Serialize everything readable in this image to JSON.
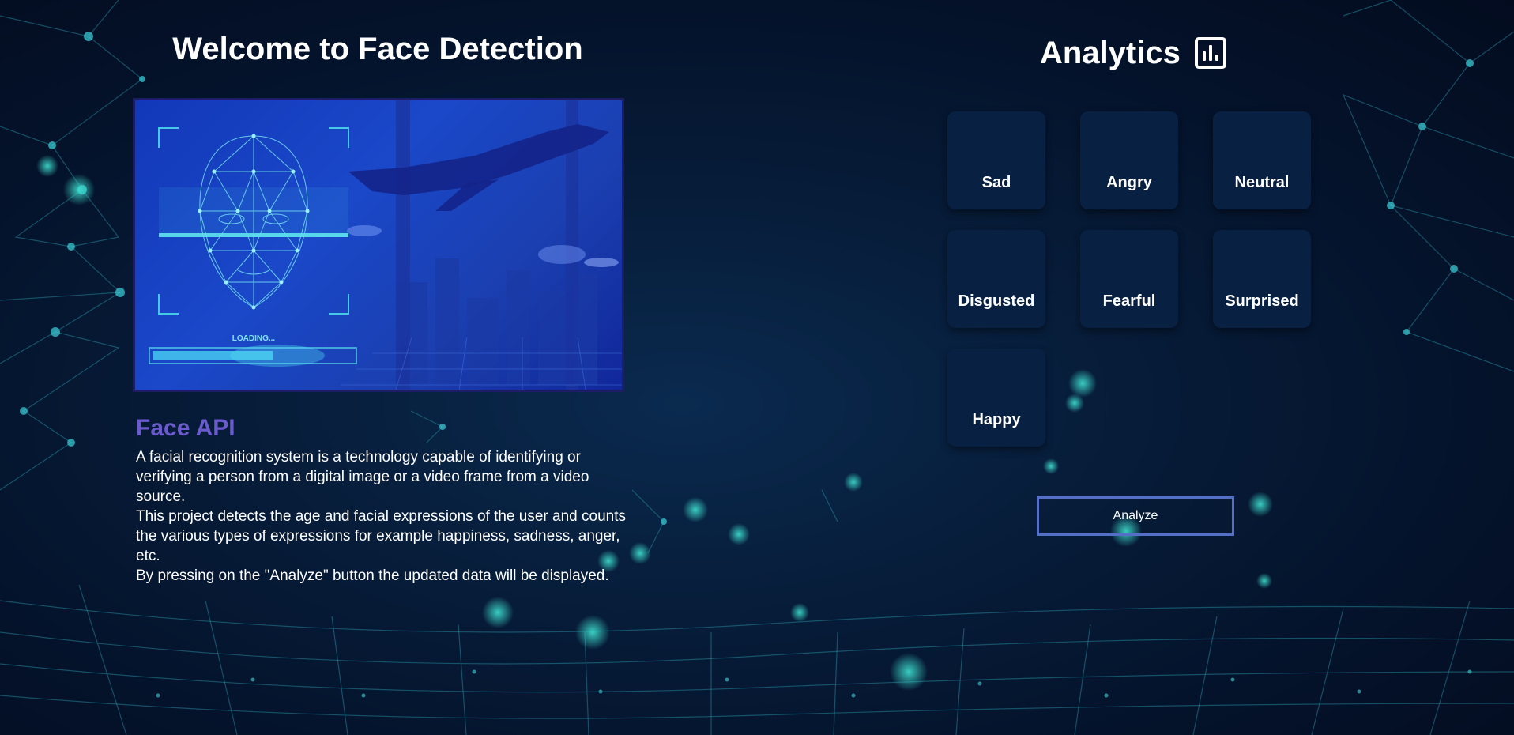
{
  "header": {
    "title": "Welcome to Face Detection"
  },
  "hero_image": {
    "loading_text": "LOADING...",
    "loading_progress": 0.6
  },
  "about": {
    "title": "Face API",
    "paragraphs": [
      "A facial recognition system is a technology capable of identifying or verifying a person from a digital image or a video frame from a video source.",
      "This project detects the age and facial expressions of the user and counts the various types of expressions for example happiness, sadness, anger, etc.",
      "By pressing on the \"Analyze\" button the updated data will be displayed."
    ]
  },
  "analytics": {
    "title": "Analytics",
    "icon": "bar-chart-icon",
    "cards": [
      {
        "label": "Sad"
      },
      {
        "label": "Angry"
      },
      {
        "label": "Neutral"
      },
      {
        "label": "Disgusted"
      },
      {
        "label": "Fearful"
      },
      {
        "label": "Surprised"
      },
      {
        "label": "Happy"
      }
    ],
    "analyze_label": "Analyze"
  },
  "colors": {
    "background": "#04122a",
    "card": "#082042",
    "accent_title": "#6a5acd",
    "button_border": "#5470c6",
    "hero_border": "#1b1e66"
  }
}
